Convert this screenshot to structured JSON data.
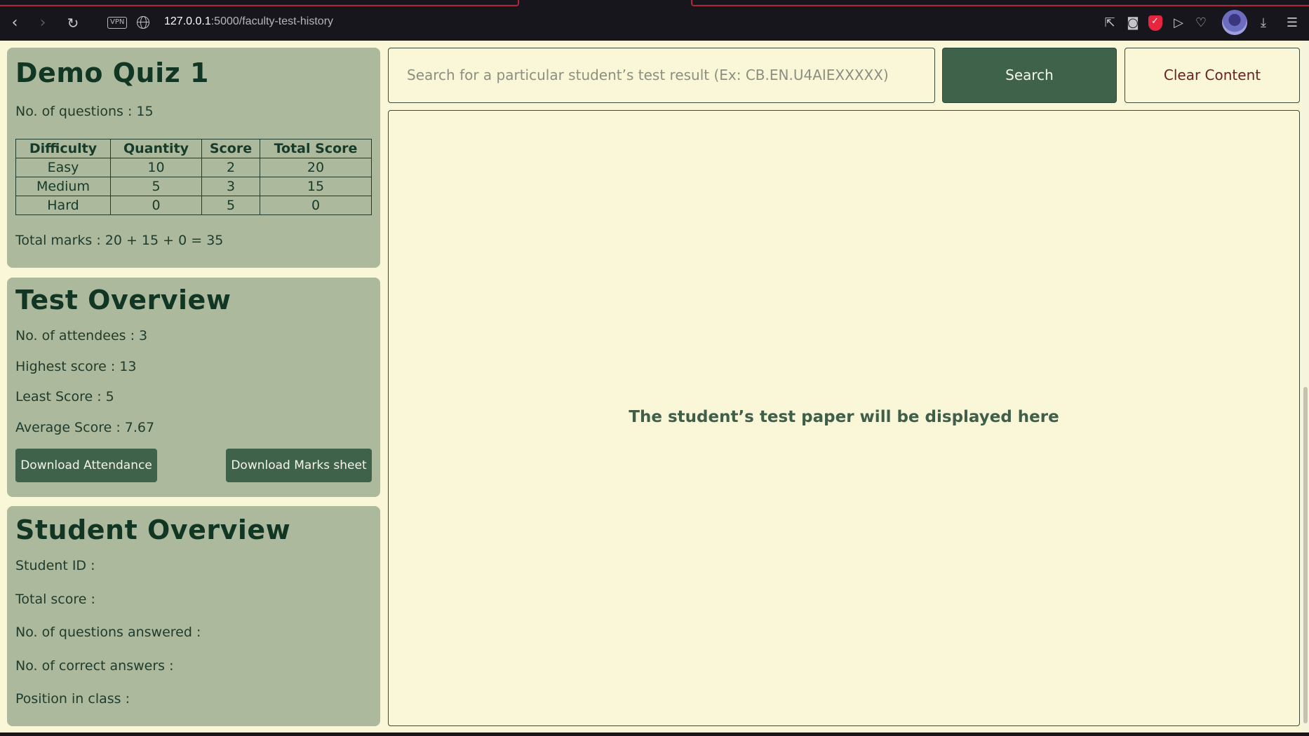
{
  "browser": {
    "url_host": "127.0.0.1",
    "url_path": ":5000/faculty-test-history",
    "vpn_label": "VPN",
    "icons": [
      "back-icon",
      "forward-icon",
      "reload-icon",
      "vpn-badge",
      "globe-icon",
      "share-icon",
      "camera-icon",
      "shield-icon",
      "send-icon",
      "heart-icon",
      "avatar",
      "download-icon",
      "menu-icon"
    ]
  },
  "quiz": {
    "title": "Demo Quiz 1",
    "num_questions": "No. of questions : 15",
    "table": {
      "headers": [
        "Difficulty",
        "Quantity",
        "Score",
        "Total Score"
      ],
      "rows": [
        [
          "Easy",
          "10",
          "2",
          "20"
        ],
        [
          "Medium",
          "5",
          "3",
          "15"
        ],
        [
          "Hard",
          "0",
          "5",
          "0"
        ]
      ]
    },
    "total_marks": "Total marks : 20 + 15 + 0 = 35"
  },
  "overview": {
    "title": "Test Overview",
    "attendees": "No. of attendees : 3",
    "highest": "Highest score : 13",
    "least": "Least Score : 5",
    "average": "Average Score : 7.67",
    "download_attendance": "Download Attendance",
    "download_marks": "Download Marks sheet"
  },
  "student": {
    "title": "Student Overview",
    "id": "Student ID :",
    "total_score": "Total score :",
    "answered": "No. of questions answered :",
    "correct": "No. of correct answers :",
    "position": "Position in class :"
  },
  "search": {
    "placeholder": "Search for a particular student’s test result (Ex: CB.EN.U4AIEXXXXX)",
    "search_label": "Search",
    "clear_label": "Clear Content"
  },
  "paper": {
    "message": "The student’s test paper will be displayed here"
  },
  "colors": {
    "page_bg": "#f9f7d8",
    "card_bg": "#adb99c",
    "accent_green": "#3f624a",
    "clear_text": "#6b1f22"
  }
}
